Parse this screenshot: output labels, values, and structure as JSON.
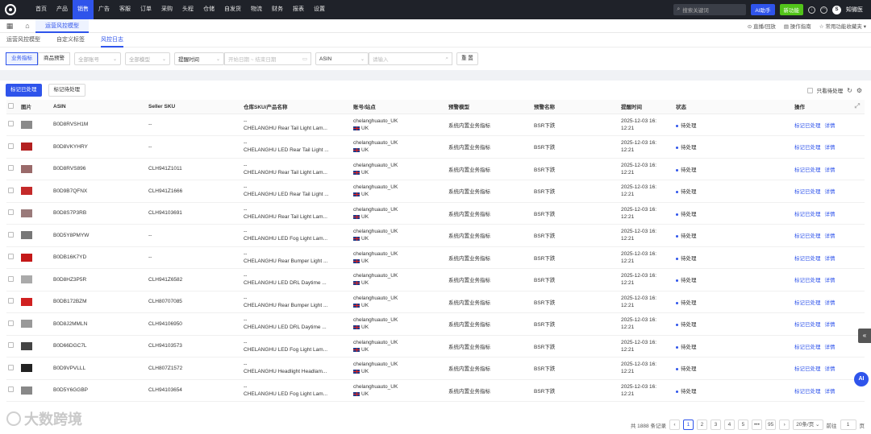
{
  "nav": {
    "items": [
      "首页",
      "产品",
      "销售",
      "广告",
      "客服",
      "订单",
      "采购",
      "头程",
      "仓储",
      "自发货",
      "物流",
      "财务",
      "报表",
      "设置"
    ],
    "active_index": 2,
    "search_placeholder": "搜索关键词",
    "ai_label": "AI助手",
    "new_label": "新功能",
    "avatar_letter": "S",
    "username": "知微医"
  },
  "tabs": {
    "active": "运营风控模型",
    "right": [
      "直播/回放",
      "操作指南",
      "常用功能收藏夹"
    ]
  },
  "subnav": {
    "items": [
      "运营风控模型",
      "自定义标签",
      "风控日志"
    ],
    "active_index": 2
  },
  "filters": {
    "segments": [
      "业务指标",
      "商品预警"
    ],
    "account_placeholder": "全部账号",
    "model_placeholder": "全部模型",
    "time_label": "提醒时间",
    "date_placeholder": "开始日期 ~ 结束日期",
    "field_label": "ASIN",
    "input_placeholder": "请输入",
    "reset_label": "重 置"
  },
  "actions": {
    "mark_done": "标记已处理",
    "mark_pending": "标记待处理",
    "only_pending": "只看待处理"
  },
  "table": {
    "headers": [
      "图片",
      "ASIN",
      "Seller SKU",
      "仓库SKU/产品名称",
      "账号/站点",
      "预警模型",
      "预警名称",
      "提醒时间",
      "状态",
      "操作"
    ],
    "rows": [
      {
        "asin": "B0D8RVSH1M",
        "sku": "--",
        "name1": "--",
        "name2": "CHELANGHU Rear Tail Light Lam...",
        "account": "chelanghuauto_UK",
        "site": "UK",
        "model": "系统内置业务指标",
        "alert": "BSR下跌",
        "time1": "2025-12-03 16:",
        "time2": "12:21",
        "status": "待处理",
        "act1": "标记已处理",
        "act2": "详情",
        "thumb_color": "#8a8a8a"
      },
      {
        "asin": "B0D8VKYHRY",
        "sku": "--",
        "name1": "--",
        "name2": "CHELANGHU LED Rear Tail Light ...",
        "account": "chelanghuauto_UK",
        "site": "UK",
        "model": "系统内置业务指标",
        "alert": "BSR下跌",
        "time1": "2025-12-03 16:",
        "time2": "12:21",
        "status": "待处理",
        "act1": "标记已处理",
        "act2": "详情",
        "thumb_color": "#b32020"
      },
      {
        "asin": "B0D8RVS896",
        "sku": "CLH941Z1011",
        "name1": "--",
        "name2": "CHELANGHU Rear Tail Light Lam...",
        "account": "chelanghuauto_UK",
        "site": "UK",
        "model": "系统内置业务指标",
        "alert": "BSR下跌",
        "time1": "2025-12-03 16:",
        "time2": "12:21",
        "status": "待处理",
        "act1": "标记已处理",
        "act2": "详情",
        "thumb_color": "#9a6a6a"
      },
      {
        "asin": "B0D9B7QFNX",
        "sku": "CLH941Z1666",
        "name1": "--",
        "name2": "CHELANGHU LED Rear Tail Light ...",
        "account": "chelanghuauto_UK",
        "site": "UK",
        "model": "系统内置业务指标",
        "alert": "BSR下跌",
        "time1": "2025-12-03 16:",
        "time2": "12:21",
        "status": "待处理",
        "act1": "标记已处理",
        "act2": "详情",
        "thumb_color": "#c42a2a"
      },
      {
        "asin": "B0D8S7P3RB",
        "sku": "CLH94103691",
        "name1": "--",
        "name2": "CHELANGHU Rear Tail Light Lam...",
        "account": "chelanghuauto_UK",
        "site": "UK",
        "model": "系统内置业务指标",
        "alert": "BSR下跌",
        "time1": "2025-12-03 16:",
        "time2": "12:21",
        "status": "待处理",
        "act1": "标记已处理",
        "act2": "详情",
        "thumb_color": "#9a7a7a"
      },
      {
        "asin": "B0D5Y8PMYW",
        "sku": "--",
        "name1": "--",
        "name2": "CHELANGHU LED Fog Light Lam...",
        "account": "chelanghuauto_UK",
        "site": "UK",
        "model": "系统内置业务指标",
        "alert": "BSR下跌",
        "time1": "2025-12-03 16:",
        "time2": "12:21",
        "status": "待处理",
        "act1": "标记已处理",
        "act2": "详情",
        "thumb_color": "#777777"
      },
      {
        "asin": "B0DB16K7YD",
        "sku": "--",
        "name1": "--",
        "name2": "CHELANGHU Rear Bumper Light ...",
        "account": "chelanghuauto_UK",
        "site": "UK",
        "model": "系统内置业务指标",
        "alert": "BSR下跌",
        "time1": "2025-12-03 16:",
        "time2": "12:21",
        "status": "待处理",
        "act1": "标记已处理",
        "act2": "详情",
        "thumb_color": "#c41818"
      },
      {
        "asin": "B0D8HZ3P5R",
        "sku": "CLH941Z6582",
        "name1": "--",
        "name2": "CHELANGHU LED DRL Daytime ...",
        "account": "chelanghuauto_UK",
        "site": "UK",
        "model": "系统内置业务指标",
        "alert": "BSR下跌",
        "time1": "2025-12-03 16:",
        "time2": "12:21",
        "status": "待处理",
        "act1": "标记已处理",
        "act2": "详情",
        "thumb_color": "#aaaaaa"
      },
      {
        "asin": "B0DB172BZM",
        "sku": "CLH80707085",
        "name1": "--",
        "name2": "CHELANGHU Rear Bumper Light ...",
        "account": "chelanghuauto_UK",
        "site": "UK",
        "model": "系统内置业务指标",
        "alert": "BSR下跌",
        "time1": "2025-12-03 16:",
        "time2": "12:21",
        "status": "待处理",
        "act1": "标记已处理",
        "act2": "详情",
        "thumb_color": "#d02020"
      },
      {
        "asin": "B0D8J2MMLN",
        "sku": "CLH94106950",
        "name1": "--",
        "name2": "CHELANGHU LED DRL Daytime ...",
        "account": "chelanghuauto_UK",
        "site": "UK",
        "model": "系统内置业务指标",
        "alert": "BSR下跌",
        "time1": "2025-12-03 16:",
        "time2": "12:21",
        "status": "待处理",
        "act1": "标记已处理",
        "act2": "详情",
        "thumb_color": "#999999"
      },
      {
        "asin": "B0D66DGC7L",
        "sku": "CLH94103573",
        "name1": "--",
        "name2": "CHELANGHU LED Fog Light Lam...",
        "account": "chelanghuauto_UK",
        "site": "UK",
        "model": "系统内置业务指标",
        "alert": "BSR下跌",
        "time1": "2025-12-03 16:",
        "time2": "12:21",
        "status": "待处理",
        "act1": "标记已处理",
        "act2": "详情",
        "thumb_color": "#444444"
      },
      {
        "asin": "B0D9VPVLLL",
        "sku": "CLH807Z1572",
        "name1": "--",
        "name2": "CHELANGHU Headlight Headlam...",
        "account": "chelanghuauto_UK",
        "site": "UK",
        "model": "系统内置业务指标",
        "alert": "BSR下跌",
        "time1": "2025-12-03 16:",
        "time2": "12:21",
        "status": "待处理",
        "act1": "标记已处理",
        "act2": "详情",
        "thumb_color": "#222222"
      },
      {
        "asin": "B0D5Y6GGBP",
        "sku": "CLH94103654",
        "name1": "--",
        "name2": "CHELANGHU LED Fog Light Lam...",
        "account": "chelanghuauto_UK",
        "site": "UK",
        "model": "系统内置业务指标",
        "alert": "BSR下跌",
        "time1": "2025-12-03 16:",
        "time2": "12:21",
        "status": "待处理",
        "act1": "标记已处理",
        "act2": "详情",
        "thumb_color": "#888888"
      }
    ]
  },
  "pager": {
    "total": "共 1888 条记录",
    "pages": [
      "1",
      "2",
      "3",
      "4",
      "5",
      "•••",
      "95"
    ],
    "active_page": "1",
    "size": "20条/页",
    "goto_label": "前往",
    "goto_value": "1",
    "page_unit": "页"
  },
  "watermark": "大数跨境",
  "ai_float": "AI"
}
